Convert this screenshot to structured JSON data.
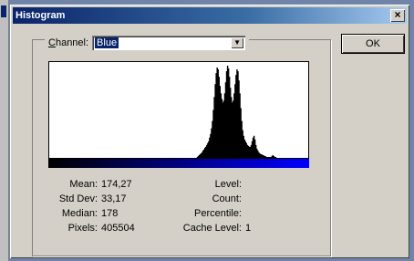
{
  "window": {
    "title": "Histogram",
    "close_glyph": "×"
  },
  "channel": {
    "label_accel": "C",
    "label_rest": "hannel:",
    "value": "Blue"
  },
  "ok_label": "OK",
  "histogram_levels": [
    0,
    0,
    0,
    0,
    0,
    0,
    0,
    0,
    0,
    0,
    0,
    0,
    0,
    0,
    0,
    0,
    0,
    0,
    0,
    0,
    0,
    0,
    0,
    0,
    0,
    0,
    0,
    0,
    0,
    0,
    0,
    0,
    0,
    0,
    0,
    0,
    0,
    0,
    0,
    0,
    0,
    0,
    0,
    0,
    0,
    0,
    0,
    0,
    0,
    0,
    0,
    0,
    0,
    0,
    0,
    0,
    0,
    0,
    0,
    0,
    0,
    0,
    0,
    0,
    0,
    0,
    0,
    0,
    0,
    0,
    0,
    0,
    0,
    0,
    0,
    0,
    0,
    0,
    0,
    0,
    0,
    0,
    0,
    0,
    0,
    0,
    0,
    0,
    0,
    0,
    0,
    0,
    0,
    0,
    0,
    0,
    0,
    0,
    0,
    0,
    0,
    0,
    0,
    0,
    0,
    0,
    0,
    0,
    0,
    0,
    0,
    0,
    0,
    0,
    0,
    0,
    0,
    0,
    0,
    0,
    0,
    0,
    0,
    0,
    0,
    0,
    0,
    0,
    0,
    0,
    0,
    0,
    0,
    0,
    0,
    0,
    0,
    0,
    0,
    0,
    0,
    0,
    0,
    0,
    0,
    0,
    0,
    0,
    0,
    0,
    0,
    0,
    0,
    0,
    0,
    0,
    1,
    2,
    3,
    4,
    5,
    6,
    8,
    9,
    11,
    12,
    14,
    16,
    18,
    22,
    26,
    32,
    40,
    52,
    66,
    80,
    92,
    98,
    96,
    88,
    78,
    70,
    64,
    60,
    62,
    70,
    82,
    94,
    100,
    97,
    88,
    76,
    66,
    60,
    62,
    70,
    80,
    90,
    96,
    94,
    84,
    70,
    54,
    40,
    30,
    24,
    20,
    18,
    16,
    14,
    13,
    12,
    12,
    14,
    18,
    22,
    24,
    20,
    14,
    10,
    8,
    6,
    5,
    4,
    4,
    3,
    3,
    2,
    2,
    1,
    1,
    1,
    1,
    1,
    1,
    2,
    3,
    2,
    1,
    1,
    0,
    0,
    0,
    0,
    0,
    0,
    0,
    0,
    0,
    0,
    0,
    0,
    0,
    0,
    0,
    0,
    0,
    0,
    0,
    0,
    0,
    0,
    0,
    0,
    0,
    0,
    0,
    0,
    0,
    0,
    0,
    0,
    0,
    0
  ],
  "stats_left": [
    {
      "label": "Mean:",
      "value": "174,27"
    },
    {
      "label": "Std Dev:",
      "value": "33,17"
    },
    {
      "label": "Median:",
      "value": "178"
    },
    {
      "label": "Pixels:",
      "value": "405504"
    }
  ],
  "stats_right": [
    {
      "label": "Level:",
      "value": ""
    },
    {
      "label": "Count:",
      "value": ""
    },
    {
      "label": "Percentile:",
      "value": ""
    },
    {
      "label": "Cache Level:",
      "value": "1"
    }
  ]
}
